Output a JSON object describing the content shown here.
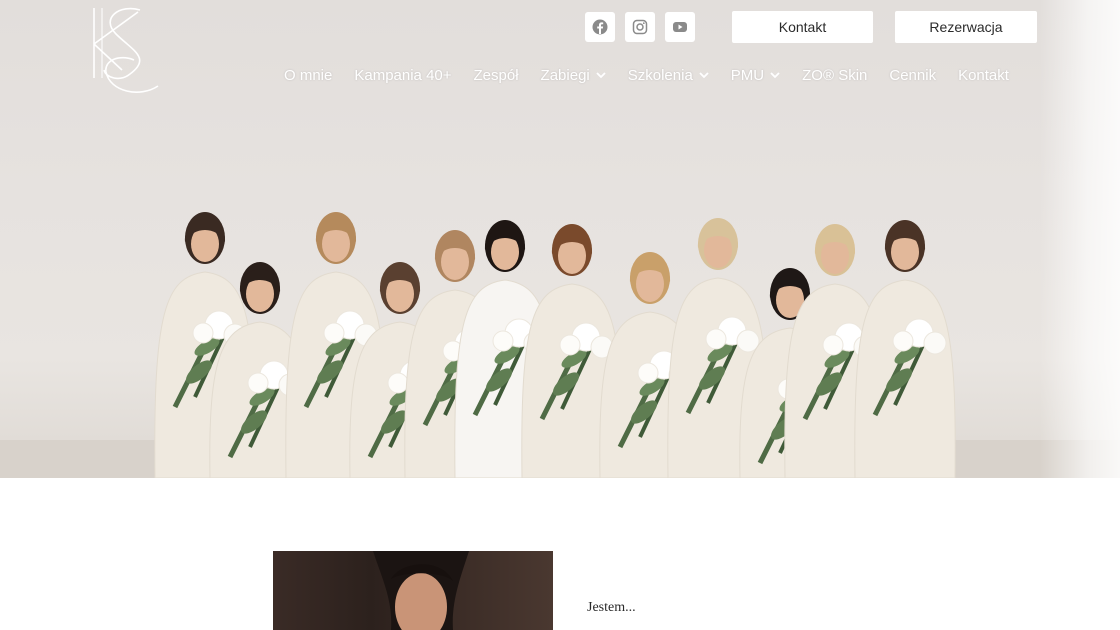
{
  "logo": {
    "text": "KS"
  },
  "social": [
    {
      "name": "facebook-icon"
    },
    {
      "name": "instagram-icon"
    },
    {
      "name": "youtube-icon"
    }
  ],
  "top_buttons": {
    "kontakt": "Kontakt",
    "rezerwacja": "Rezerwacja"
  },
  "nav": [
    {
      "label": "O mnie",
      "dropdown": false
    },
    {
      "label": "Kampania 40+",
      "dropdown": false
    },
    {
      "label": "Zespół",
      "dropdown": false
    },
    {
      "label": "Zabiegi",
      "dropdown": true
    },
    {
      "label": "Szkolenia",
      "dropdown": true
    },
    {
      "label": "PMU",
      "dropdown": true
    },
    {
      "label": "ZO® Skin",
      "dropdown": false
    },
    {
      "label": "Cennik",
      "dropdown": false
    },
    {
      "label": "Kontakt",
      "dropdown": false
    }
  ],
  "about": {
    "intro": "Jestem..."
  },
  "colors": {
    "nav_text": "#ffffff",
    "hero_bg": "#e4e0dc",
    "social_icon": "#8a8a8a"
  }
}
